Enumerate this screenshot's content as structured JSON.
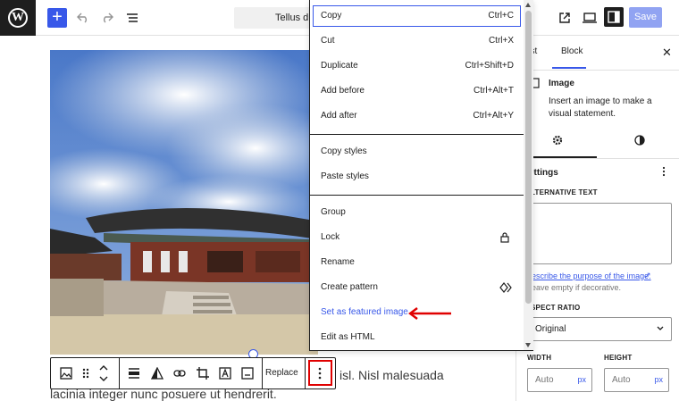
{
  "topbar": {
    "document_title": "Tellus dui",
    "save_label": "Save"
  },
  "canvas": {
    "paragraph_line_1": "isl. Nisl malesuada",
    "paragraph_line_2": "lacinia integer nunc posuere ut hendrerit."
  },
  "block_toolbar": {
    "replace_label": "Replace",
    "icons": [
      "image-icon",
      "drag-handle-icon",
      "move-up-down-icon",
      "align-icon",
      "duotone-icon",
      "link-icon",
      "crop-icon",
      "text-overlay-icon",
      "caption-icon",
      "more-options-icon"
    ]
  },
  "menu": {
    "group1": [
      {
        "label": "Copy",
        "shortcut": "Ctrl+C"
      },
      {
        "label": "Cut",
        "shortcut": "Ctrl+X"
      },
      {
        "label": "Duplicate",
        "shortcut": "Ctrl+Shift+D"
      },
      {
        "label": "Add before",
        "shortcut": "Ctrl+Alt+T"
      },
      {
        "label": "Add after",
        "shortcut": "Ctrl+Alt+Y"
      }
    ],
    "group2": [
      {
        "label": "Copy styles"
      },
      {
        "label": "Paste styles"
      }
    ],
    "group3": [
      {
        "label": "Group"
      },
      {
        "label": "Lock",
        "icon": "lock-icon"
      },
      {
        "label": "Rename"
      },
      {
        "label": "Create pattern",
        "icon": "pattern-icon"
      },
      {
        "label": "Set as featured image"
      },
      {
        "label": "Edit as HTML"
      }
    ]
  },
  "sidebar": {
    "tabs": [
      "ost",
      "Block"
    ],
    "block_name": "Image",
    "block_description": "Insert an image to make a visual statement.",
    "section_title": "ettings",
    "alt_text_label": "LTERNATIVE TEXT",
    "alt_help_link": "escribe the purpose of the image.",
    "alt_help_note": "eave empty if decorative.",
    "aspect_ratio_label": "SPECT RATIO",
    "aspect_ratio_value": "Original",
    "width_label": "WIDTH",
    "height_label": "HEIGHT",
    "width_placeholder": "Auto",
    "height_placeholder": "Auto",
    "unit": "px"
  },
  "colors": {
    "accent": "#3858e9",
    "annotation": "#e00000",
    "highlight_link": "#3858e9"
  }
}
